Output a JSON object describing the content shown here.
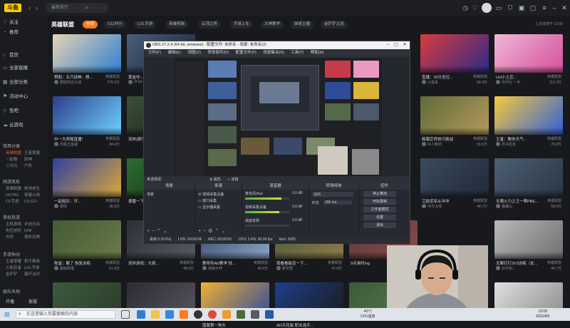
{
  "topbar": {
    "logo": "斗鱼",
    "search_placeholder": "最新前行",
    "icons": [
      "clock-icon",
      "heart-icon",
      "message-icon",
      "shirt-icon",
      "box-icon",
      "package-icon",
      "menu-icon",
      "minimize-icon",
      "maximize-icon",
      "close-icon"
    ]
  },
  "sidebar": {
    "items": [
      {
        "label": "关注",
        "icon": "heart-icon"
      },
      {
        "label": "推荐",
        "icon": "thumb-icon"
      },
      {
        "label": "首页",
        "icon": "home-icon"
      },
      {
        "label": "全部直播",
        "icon": "tv-icon"
      },
      {
        "label": "全部分类",
        "icon": "grid-icon"
      },
      {
        "label": "活动中心",
        "icon": "flag-icon"
      },
      {
        "label": "鱼吧",
        "icon": "fish-icon"
      },
      {
        "label": "云游戏",
        "icon": "cloud-icon"
      }
    ],
    "sections": [
      {
        "title": "常用分类",
        "entries": [
          "英雄联盟",
          "王者荣耀",
          "一起看",
          "原神",
          "二次元",
          "户外"
        ]
      },
      {
        "title": "网游竞技",
        "entries": [
          "英雄联盟",
          "绝地求生",
          "DOTA2",
          "穿越火线",
          "CF手游",
          "CS:GO"
        ]
      },
      {
        "title": "单机热游",
        "entries": [
          "主机游戏",
          "永劫无间",
          "失控进化",
          "DNF",
          "方舟",
          "使命召唤"
        ]
      },
      {
        "title": "手游休闲",
        "entries": [
          "王者荣耀",
          "和平精英",
          "火影忍者",
          "LOL手游",
          "金铲铲",
          "蛋仔派对"
        ]
      },
      {
        "title": "娱乐天地"
      }
    ],
    "bottom": {
      "label": "开播",
      "extra": "客服"
    }
  },
  "main": {
    "title": "英雄联盟",
    "tabs": [
      "全部",
      "S12冲分",
      "LOL手游",
      "英雄剪辑",
      "云顶之弈",
      "手组上车",
      "大神教学",
      "妹纸主播",
      "金铲铲之战"
    ],
    "active_tab": "全部",
    "note": "上次浏览于 12:06"
  },
  "cards": [
    {
      "title": "帮助：五只战神、想...",
      "game": "英雄联盟",
      "streamer": "帮助你五只战",
      "views": "275.6万",
      "colors": [
        "#e8d3b4",
        "#2f7fd1"
      ]
    },
    {
      "title": "黄金夺...",
      "game": "英雄联盟",
      "streamer": "Jf-Uz...",
      "views": "",
      "colors": [
        "#4a5e7a",
        "#1c2436"
      ]
    },
    {
      "title": "直播：20分全位...",
      "game": "英雄联盟",
      "streamer": "小蛋哥",
      "views": "56.4万",
      "colors": [
        "#d93b3b",
        "#2b2b8a"
      ]
    },
    {
      "title": "Uzi小土豆...",
      "game": "英雄联盟",
      "streamer": "月冲分 一手",
      "views": "112.3万",
      "colors": [
        "#f0b7d6",
        "#d44f9b"
      ]
    },
    {
      "title": "中一大师局直播!",
      "game": "英雄联盟",
      "streamer": "司机丘蛋咸",
      "views": "84.4万",
      "colors": [
        "#2c3f8a",
        "#6fd0ff"
      ]
    },
    {
      "title": "双休(娱乐)...",
      "game": "英雄联盟",
      "streamer": "",
      "views": "",
      "colors": [
        "#3a4f3a",
        "#1a1f1a"
      ]
    },
    {
      "title": "韩服宗师技巧挑战",
      "game": "英雄联盟",
      "streamer": "中人新旧",
      "views": "56.5万",
      "colors": [
        "#5f6a3a",
        "#b49a5c"
      ]
    },
    {
      "title": "王者：教你天气...",
      "game": "英雄联盟",
      "streamer": "月书坦克",
      "views": "76.8万",
      "colors": [
        "#f8c83d",
        "#2f60d9"
      ]
    },
    {
      "title": "一起组队：开...",
      "game": "英雄联盟",
      "streamer": "游凤",
      "views": "36.8万",
      "colors": [
        "#2f3fa0",
        "#d9a93b"
      ]
    },
    {
      "title": "德雷一下...",
      "game": "英雄联盟",
      "streamer": "",
      "views": "",
      "colors": [
        "#2a6e2f",
        "#1d2a1d"
      ]
    },
    {
      "title": "艾欧尼亚从冲冲",
      "game": "英雄联盟",
      "streamer": "中方大师",
      "views": "44.7万",
      "colors": [
        "#3c4a5e",
        "#1f2a38"
      ]
    },
    {
      "title": "无限火力之王一帮PBE...",
      "game": "英雄联盟",
      "streamer": "猫猫山",
      "views": "58.6万",
      "colors": [
        "#4d5f72",
        "#293746"
      ]
    },
    {
      "title": "陈留：解了 恢复训练",
      "game": "英雄联盟",
      "streamer": "超级助理",
      "views": "51.9万",
      "colors": [
        "#435a33",
        "#6b7a4a"
      ]
    },
    {
      "title": "双休游戏：大局...",
      "game": "英雄联盟",
      "streamer": "",
      "views": "48.8万",
      "colors": [
        "#2c3036",
        "#555a62"
      ]
    },
    {
      "title": "教导传AD教学 技...",
      "game": "英雄联盟",
      "streamer": "高级伙伴",
      "views": "46.5万",
      "colors": [
        "#3a4b6a",
        "#8aa3c4"
      ]
    },
    {
      "title": "我看看能否一下...",
      "game": "英雄联盟",
      "streamer": "数字帮",
      "views": "47.6万",
      "colors": [
        "#4f5a3a",
        "#8c7a4a"
      ]
    },
    {
      "title": "9点准时ing",
      "game": "英雄联盟",
      "streamer": "",
      "views": "",
      "colors": [
        "#5a3a3a",
        "#8c4a4a"
      ]
    },
    {
      "title": "无聊打打3V3训练（女...",
      "game": "英雄联盟",
      "streamer": "日不如...",
      "views": "40.7万",
      "colors": [
        "#b8b8b8",
        "#707070"
      ]
    },
    {
      "title": "",
      "game": "",
      "streamer": "",
      "views": "",
      "colors": [
        "#3c5a3c",
        "#2a3a2a"
      ]
    },
    {
      "title": "",
      "game": "",
      "streamer": "",
      "views": "",
      "colors": [
        "#2c2c34",
        "#55555e"
      ]
    },
    {
      "title": "国服第一狗头",
      "game": "",
      "streamer": "",
      "views": "",
      "colors": [
        "#f0b030",
        "#2a4aa0"
      ]
    },
    {
      "title": "AD天花板 职业选手...",
      "game": "",
      "streamer": "",
      "views": "",
      "colors": [
        "#1e3f8a",
        "#1a1a1a"
      ]
    },
    {
      "title": "",
      "game": "",
      "streamer": "",
      "views": "",
      "colors": [
        "#3a5a3a",
        "#5a7a4a"
      ]
    },
    {
      "title": "",
      "game": "",
      "streamer": "",
      "views": "",
      "colors": [
        "#e0e0e0",
        "#8a8a8a"
      ]
    }
  ],
  "obs": {
    "title": "OBS 27.2.4 (64 bit, windows) - 配置文件: 未命名 - 场景: 未命名(2)",
    "menu": [
      "文件(F)",
      "编辑(E)",
      "视图(V)",
      "停靠部件(D)",
      "配置文件(P)",
      "场景集合(S)",
      "工具(T)",
      "帮助(H)"
    ],
    "toolbar_left": "未选择源",
    "toolbar_props": "属性",
    "toolbar_filters": "滤镜",
    "docks": {
      "scenes": {
        "head": "场景",
        "items": [
          "场景"
        ]
      },
      "sources": {
        "head": "来源",
        "items": [
          "视频采集设备",
          "窗口采集",
          "显示器采集"
        ]
      },
      "mixer": {
        "head": "混音器",
        "items": [
          {
            "name": "麦克风/Aux",
            "db": "0.0 dB",
            "level": 0.82
          },
          {
            "name": "视频采集设备",
            "db": "0.0 dB",
            "level": 0.78
          },
          {
            "name": "桌面音频",
            "db": "0.0 dB",
            "level": 0.0
          }
        ]
      },
      "transitions": {
        "head": "转场特效",
        "mode": "淡出",
        "duration_label": "时长",
        "duration": "300 ms"
      },
      "controls": {
        "head": "控件",
        "buttons": [
          "停止推流",
          "开始录制",
          "工作室模式",
          "设置",
          "退出"
        ]
      }
    },
    "status": {
      "live": "LIVE: 00:00:04",
      "rec": "REC: 00:00:00",
      "cpu": "CPU: 3.4%, 60.00 fps",
      "dropped": "丢帧 0 (0.0%)",
      "kbps": "kb/s: 5925"
    }
  },
  "taskbar": {
    "search_placeholder": "在这里输入你要搜索的内容",
    "weather_temp": "40°C",
    "weather_label": "CPU温度",
    "time": "12:09",
    "date": "2022/8/6",
    "apps": [
      "task-view-icon",
      "edge-icon",
      "explorer-icon",
      "store-icon",
      "douyu-icon",
      "obs-icon",
      "chrome-icon",
      "app-icon",
      "app-icon",
      "app-icon",
      "app-icon"
    ]
  }
}
